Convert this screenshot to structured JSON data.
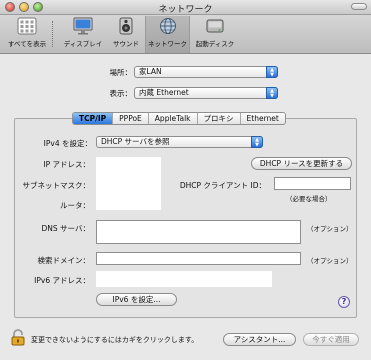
{
  "window": {
    "title": "ネットワーク"
  },
  "toolbar": {
    "show_all": "すべてを表示",
    "items": [
      {
        "label": "ディスプレイ",
        "icon": "display-icon"
      },
      {
        "label": "サウンド",
        "icon": "speaker-icon"
      },
      {
        "label": "ネットワーク",
        "icon": "globe-icon",
        "selected": true
      },
      {
        "label": "起動ディスク",
        "icon": "disk-icon"
      }
    ]
  },
  "location": {
    "label": "場所：",
    "value": "家LAN"
  },
  "show": {
    "label": "表示：",
    "value": "内蔵 Ethernet"
  },
  "tabs": [
    {
      "label": "TCP/IP",
      "active": true
    },
    {
      "label": "PPPoE"
    },
    {
      "label": "AppleTalk"
    },
    {
      "label": "プロキシ"
    },
    {
      "label": "Ethernet"
    }
  ],
  "ipv4": {
    "label": "IPv4 を設定：",
    "value": "DHCP サーバを参照"
  },
  "ip_address": {
    "label": "IP アドレス：",
    "value": ""
  },
  "subnet": {
    "label": "サブネットマスク：",
    "value": ""
  },
  "router": {
    "label": "ルータ：",
    "value": ""
  },
  "renew_button": "DHCP リースを更新する",
  "dhcp_client": {
    "label": "DHCP クライアント ID：",
    "value": "",
    "note": "（必要な場合）"
  },
  "dns": {
    "label": "DNS サーバ：",
    "value": "",
    "note": "（オプション）"
  },
  "search_domain": {
    "label": "検索ドメイン：",
    "value": "",
    "note": "（オプション）"
  },
  "ipv6": {
    "label": "IPv6 アドレス：",
    "value": ""
  },
  "ipv6_button": "IPv6 を設定...",
  "help": "?",
  "footer": {
    "lock_text": "変更できないようにするにはカギをクリックします。",
    "assistant_button": "アシスタント...",
    "apply_button": "今すぐ適用"
  },
  "colors": {
    "accent": "#2a77e0",
    "window_bg": "#e8e8e8"
  }
}
